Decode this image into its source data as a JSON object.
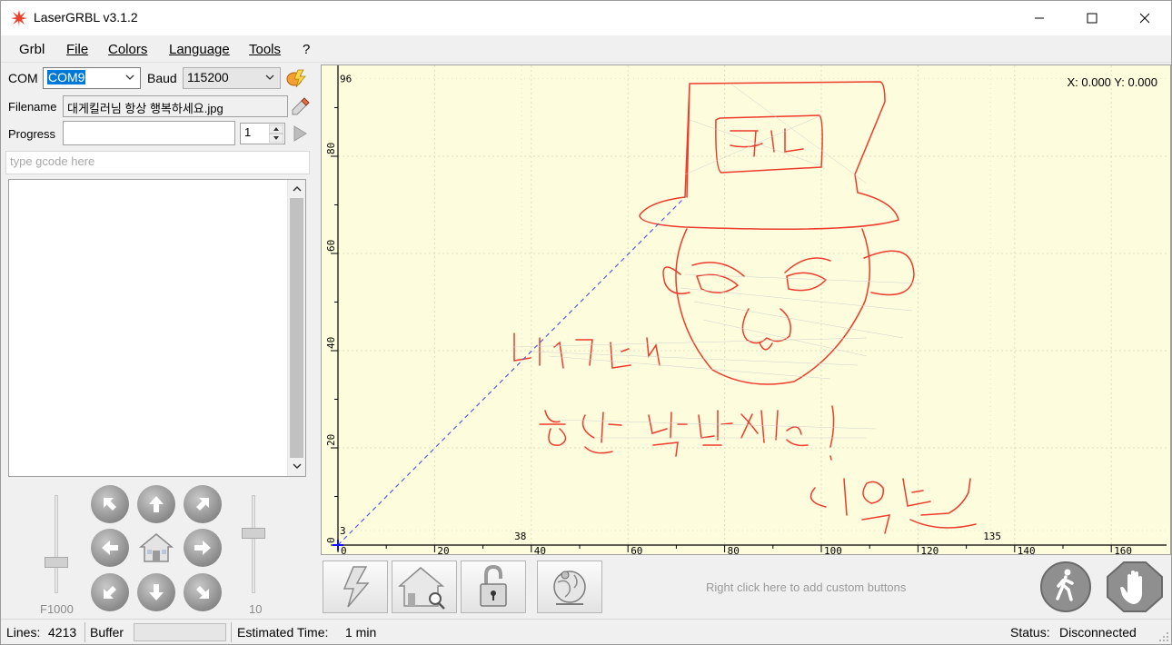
{
  "window": {
    "title": "LaserGRBL v3.1.2"
  },
  "menu": [
    "Grbl",
    "File",
    "Colors",
    "Language",
    "Tools",
    "?"
  ],
  "connection": {
    "com_label": "COM",
    "com_value": "COM9",
    "baud_label": "Baud",
    "baud_value": "115200"
  },
  "file": {
    "filename_label": "Filename",
    "filename_value": "대게킬러님 항상 행복하세요.jpg",
    "progress_label": "Progress",
    "progress_value": 0,
    "passes": "1"
  },
  "gcode_input": {
    "placeholder": "type gcode here",
    "value": ""
  },
  "jog": {
    "feed_label": "F1000",
    "step_label": "10"
  },
  "preview": {
    "coords": "X: 0.000 Y: 0.000",
    "x_ticks": [
      "0",
      "20",
      "40",
      "60",
      "80",
      "100",
      "120",
      "140",
      "160"
    ],
    "y_ticks": [
      "0",
      "20",
      "40",
      "60",
      "80"
    ],
    "x_markers": [
      "38",
      "135"
    ],
    "y_markers": [
      "3",
      "96"
    ]
  },
  "toolbar": {
    "custom_hint": "Right click here to add custom buttons"
  },
  "status": {
    "lines_label": "Lines:",
    "lines_value": "4213",
    "buffer_label": "Buffer",
    "est_label": "Estimated Time:",
    "est_value": "1 min",
    "status_label": "Status:",
    "status_value": "Disconnected"
  },
  "colors": {
    "accent": "#e8412e",
    "preview_bg": "#fdfdde",
    "drawing": "#ee3b2b"
  }
}
